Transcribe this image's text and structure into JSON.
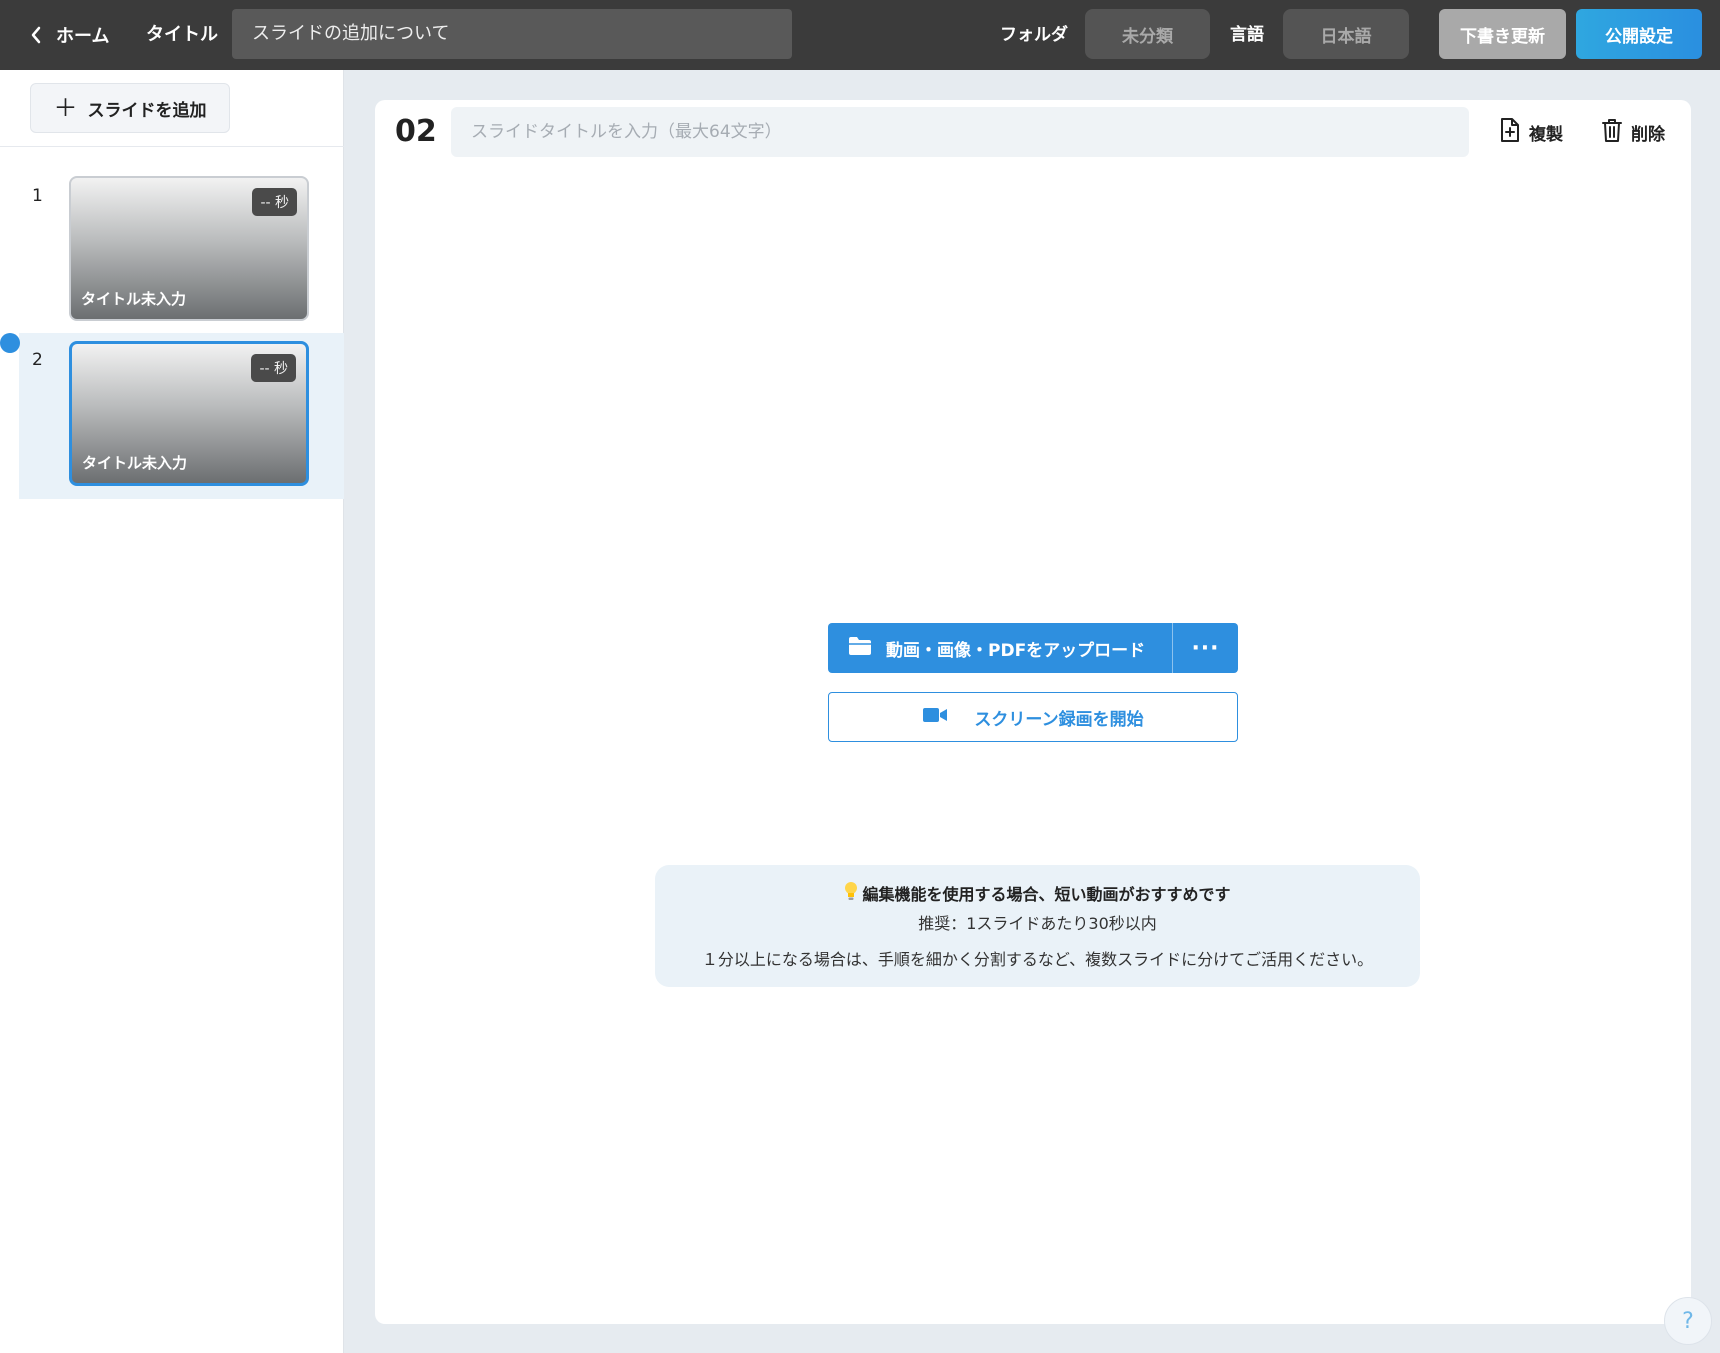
{
  "topbar": {
    "home_label": "ホーム",
    "title_label": "タイトル",
    "title_value": "スライドの追加について",
    "folder_label": "フォルダ",
    "folder_value": "未分類",
    "language_label": "言語",
    "language_value": "日本語",
    "draft_button": "下書き更新",
    "publish_button": "公開設定"
  },
  "sidebar": {
    "add_slide_label": "スライドを追加",
    "slides": [
      {
        "number": "1",
        "duration": "-- 秒",
        "title": "タイトル未入力",
        "active": false
      },
      {
        "number": "2",
        "duration": "-- 秒",
        "title": "タイトル未入力",
        "active": true
      }
    ]
  },
  "editor": {
    "slide_index": "02",
    "title_placeholder": "スライドタイトルを入力（最大64文字）",
    "duplicate_label": "複製",
    "delete_label": "削除",
    "upload_label": "動画・画像・PDFをアップロード",
    "more_label": "···",
    "record_label": "スクリーン録画を開始",
    "tip": {
      "heading": "編集機能を使用する場合、短い動画がおすすめです",
      "recommend": "推奨：1スライドあたり30秒以内",
      "body": "１分以上になる場合は、手順を細かく分割するなど、複数スライドに分けてご活用ください。"
    }
  },
  "help_label": "?",
  "colors": {
    "accent": "#2e8fdf",
    "topbar": "#3b3b3b"
  }
}
